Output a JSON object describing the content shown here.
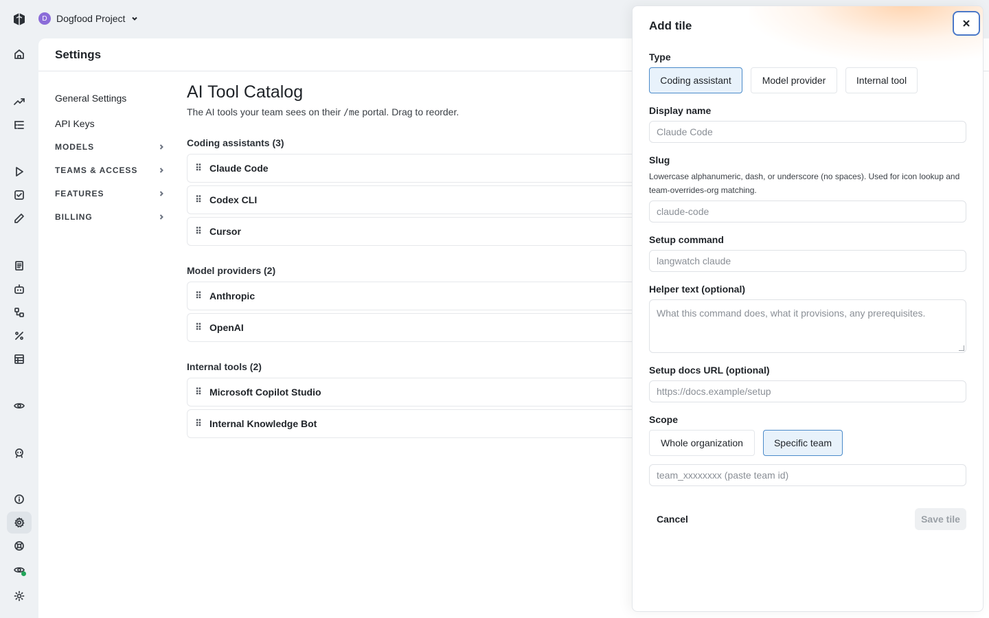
{
  "project": {
    "initial": "D",
    "name": "Dogfood Project"
  },
  "header": {
    "title": "Settings"
  },
  "sidebar": {
    "items": [
      {
        "label": "General Settings"
      },
      {
        "label": "API Keys"
      }
    ],
    "groups": [
      {
        "label": "MODELS"
      },
      {
        "label": "TEAMS & ACCESS"
      },
      {
        "label": "FEATURES"
      },
      {
        "label": "BILLING"
      }
    ]
  },
  "catalog": {
    "title": "AI Tool Catalog",
    "subtitle_pre": "The AI tools your team sees on their ",
    "subtitle_code": "/me",
    "subtitle_post": " portal. Drag to reorder.",
    "sections": [
      {
        "title": "Coding assistants (3)",
        "tiles": [
          "Claude Code",
          "Codex CLI",
          "Cursor"
        ]
      },
      {
        "title": "Model providers (2)",
        "tiles": [
          "Anthropic",
          "OpenAI"
        ]
      },
      {
        "title": "Internal tools (2)",
        "tiles": [
          "Microsoft Copilot Studio",
          "Internal Knowledge Bot"
        ]
      }
    ]
  },
  "drawer": {
    "title": "Add tile",
    "type_label": "Type",
    "type_options": [
      "Coding assistant",
      "Model provider",
      "Internal tool"
    ],
    "type_selected": "Coding assistant",
    "display_name_label": "Display name",
    "display_name_placeholder": "Claude Code",
    "slug_label": "Slug",
    "slug_help": "Lowercase alphanumeric, dash, or underscore (no spaces). Used for icon lookup and team-overrides-org matching.",
    "slug_placeholder": "claude-code",
    "setup_label": "Setup command",
    "setup_placeholder": "langwatch claude",
    "helper_label": "Helper text (optional)",
    "helper_placeholder": "What this command does, what it provisions, any prerequisites.",
    "docs_label": "Setup docs URL (optional)",
    "docs_placeholder": "https://docs.example/setup",
    "scope_label": "Scope",
    "scope_options": [
      "Whole organization",
      "Specific team"
    ],
    "scope_selected": "Specific team",
    "team_placeholder": "team_xxxxxxxx (paste team id)",
    "cancel": "Cancel",
    "save": "Save tile"
  }
}
